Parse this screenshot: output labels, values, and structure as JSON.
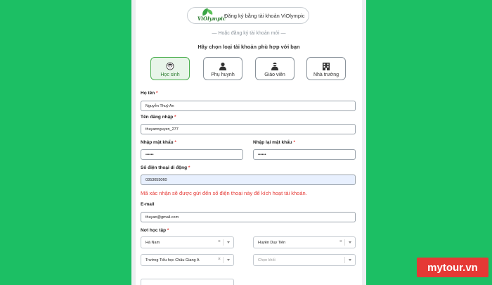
{
  "header": {
    "vio_button_label": "Đăng ký bằng tài khoản ViOlympic",
    "vio_logo_text": "ViOlympic",
    "alt_text": "— Hoặc đăng ký tài khoản mới —",
    "choose_title": "Hãy chọn loại tài khoản phù hợp với bạn"
  },
  "account_types": [
    {
      "label": "Học sinh",
      "icon": "student-icon",
      "active": true
    },
    {
      "label": "Phụ huynh",
      "icon": "parent-icon",
      "active": false
    },
    {
      "label": "Giáo viên",
      "icon": "teacher-icon",
      "active": false
    },
    {
      "label": "Nhà trường",
      "icon": "school-icon",
      "active": false
    }
  ],
  "form": {
    "fullname_label": "Họ tên",
    "fullname_value": "Nguyễn Thuý An",
    "username_label": "Tên đăng nhập",
    "username_value": "thuyannguyen_277",
    "password_label": "Nhập mật khẩu",
    "password_value": "••••••",
    "confirm_label": "Nhập lại mật khẩu",
    "confirm_value": "••••••",
    "phone_label": "Số điện thoại di động",
    "phone_value": "0353055060",
    "notice": "Mã xác nhận sẽ được gửi đến số điện thoại này để kích hoạt tài khoản.",
    "email_label": "E-mail",
    "email_value": "thuyan@gmail.com",
    "school_label": "Nơi học tập",
    "province_value": "Hà Nam",
    "district_value": "Huyện Duy Tiên",
    "school_value": "Trường Tiểu học Châu Giang A",
    "grade_placeholder": "Chọn khối",
    "required_mark": "*"
  },
  "brand": {
    "text": "mytour.vn"
  },
  "colors": {
    "green": "#1cbf64",
    "required": "#e53935",
    "brand": "#e53935"
  }
}
